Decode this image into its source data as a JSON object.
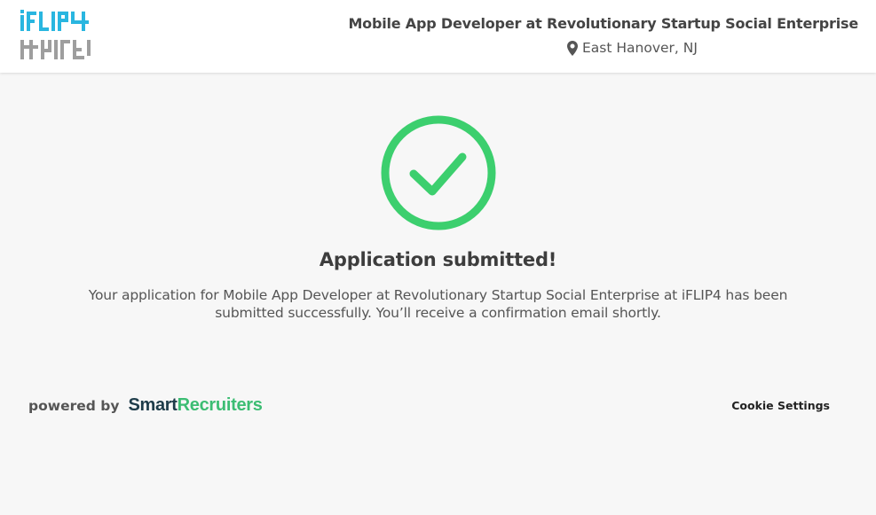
{
  "header": {
    "logo_alt": "iFLIP4",
    "job_title": "Mobile App Developer at Revolutionary Startup Social Enterprise",
    "location": "East Hanover, NJ",
    "location_icon": "map-pin-icon"
  },
  "confirmation": {
    "icon": "check-circle-icon",
    "title": "Application submitted!",
    "message": "Your application for Mobile App Developer at Revolutionary Startup Social Enterprise at iFLIP4 has been submitted successfully. You’ll receive a confirmation email shortly."
  },
  "footer": {
    "powered_by": "powered by",
    "brand_part1": "Smart",
    "brand_part2": "Recruiters",
    "cookie_settings": "Cookie Settings"
  },
  "colors": {
    "success_green": "#3ccf6e",
    "logo_blue": "#29b6e0",
    "logo_gray": "#9e9e9e",
    "brand_navy": "#1e3c4a",
    "brand_green": "#3cbd73",
    "background": "#f7f7f7"
  }
}
